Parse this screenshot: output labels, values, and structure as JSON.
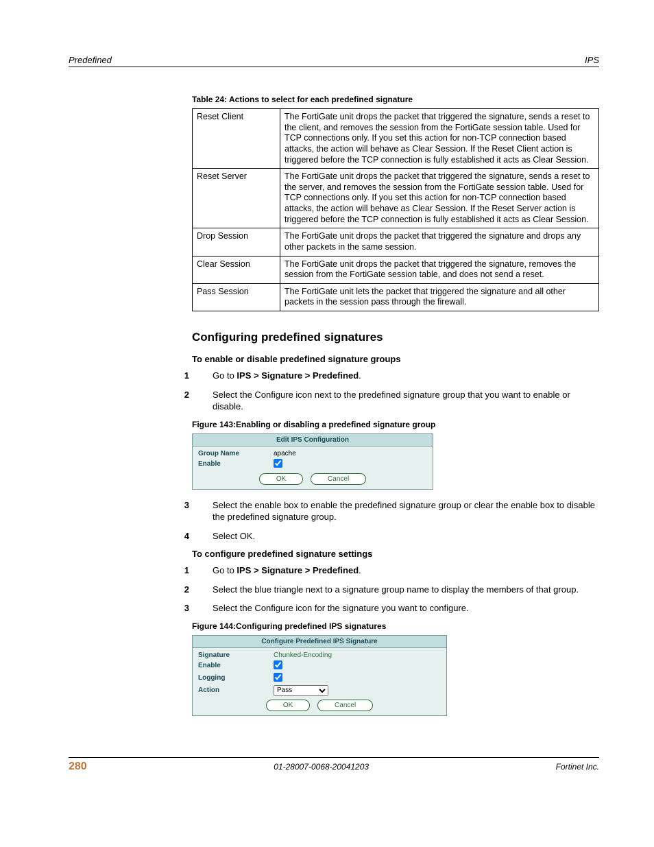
{
  "header": {
    "left": "Predefined",
    "right": "IPS"
  },
  "table": {
    "caption": "Table 24: Actions to select for each predefined signature",
    "rows": [
      {
        "name": "Reset Client",
        "desc": "The FortiGate unit drops the packet that triggered the signature, sends a reset to the client, and removes the session from the FortiGate session table. Used for TCP connections only. If you set this action for non-TCP connection based attacks, the action will behave as Clear Session. If the Reset Client action is triggered before the TCP connection is fully established it acts as Clear Session."
      },
      {
        "name": "Reset Server",
        "desc": "The FortiGate unit drops the packet that triggered the signature, sends a reset to the server, and removes the session from the FortiGate session table. Used for TCP connections only. If you set this action for non-TCP connection based attacks, the action will behave as Clear Session. If the Reset Server action is triggered before the TCP connection is fully established it acts as Clear Session."
      },
      {
        "name": "Drop Session",
        "desc": "The FortiGate unit drops the packet that triggered the signature and drops any other packets in the same session."
      },
      {
        "name": "Clear Session",
        "desc": "The FortiGate unit drops the packet that triggered the signature, removes the session from the FortiGate session table, and does not send a reset."
      },
      {
        "name": "Pass Session",
        "desc": "The FortiGate unit lets the packet that triggered the signature and all other packets in the session pass through the firewall."
      }
    ]
  },
  "section_heading": "Configuring predefined signatures",
  "procA": {
    "title": "To enable or disable predefined signature groups",
    "goto_prefix": "Go to ",
    "goto_bold": "IPS > Signature > Predefined",
    "step2": "Select the Configure icon next to the predefined signature group that you want to enable or disable.",
    "step3": "Select the enable box to enable the predefined signature group or clear the enable box to disable the predefined signature group.",
    "step4": "Select OK."
  },
  "fig143": {
    "caption": "Figure 143:Enabling or disabling a predefined signature group",
    "title": "Edit IPS Configuration",
    "group_name_label": "Group Name",
    "group_name_value": "apache",
    "enable_label": "Enable",
    "ok": "OK",
    "cancel": "Cancel"
  },
  "procB": {
    "title": "To configure predefined signature settings",
    "goto_prefix": "Go to ",
    "goto_bold": "IPS > Signature > Predefined",
    "step2": "Select the blue triangle next to a signature group name to display the members of that group.",
    "step3": "Select the Configure icon for the signature you want to configure."
  },
  "fig144": {
    "caption": "Figure 144:Configuring predefined IPS signatures",
    "title": "Configure Predefined IPS Signature",
    "signature_label": "Signature",
    "signature_value": "Chunked-Encoding",
    "enable_label": "Enable",
    "logging_label": "Logging",
    "action_label": "Action",
    "action_value": "Pass",
    "ok": "OK",
    "cancel": "Cancel"
  },
  "footer": {
    "page": "280",
    "doc_id": "01-28007-0068-20041203",
    "company": "Fortinet Inc."
  }
}
